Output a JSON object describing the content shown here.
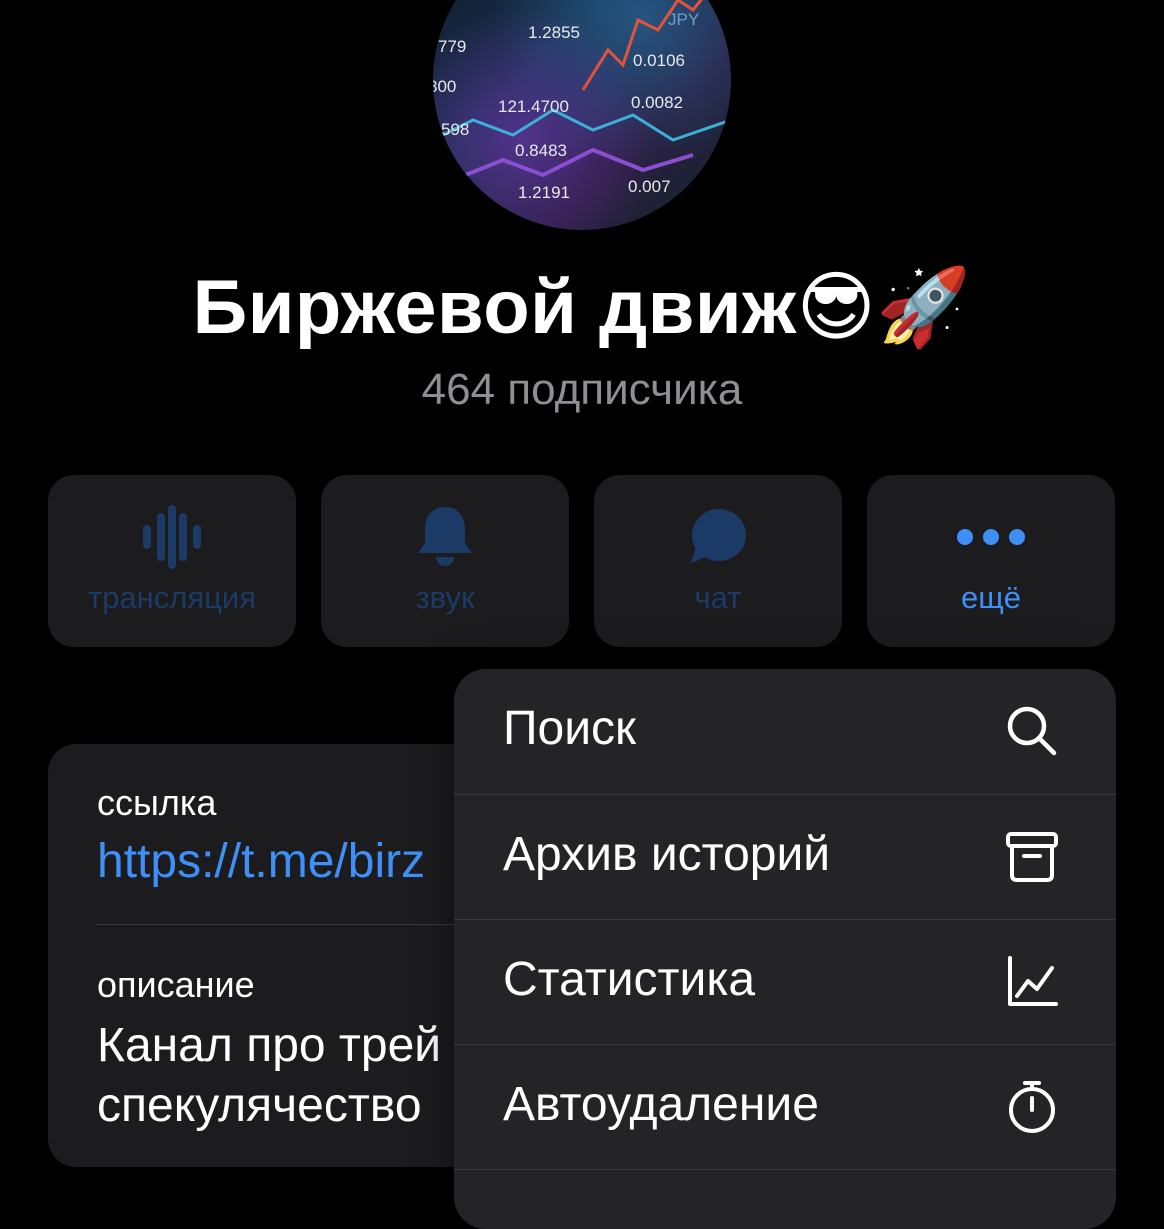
{
  "channel": {
    "title": "Биржевой движ😎🚀",
    "subscribers": "464 подписчика",
    "avatar_numbers": [
      "1.2855",
      "JPY",
      "779",
      "0.0106",
      "800",
      "121.4700",
      "0.0082",
      "598",
      "0.8483",
      "1.2191",
      "0.007"
    ]
  },
  "actions": [
    {
      "label": "трансляция",
      "icon": "broadcast-icon",
      "active": false
    },
    {
      "label": "звук",
      "icon": "bell-icon",
      "active": false
    },
    {
      "label": "чат",
      "icon": "chat-bubble-icon",
      "active": false
    },
    {
      "label": "ещё",
      "icon": "more-dots-icon",
      "active": true
    }
  ],
  "info": {
    "link_caption": "ссылка",
    "link_value": "https://t.me/birz",
    "description_caption": "описание",
    "description_value": "Канал про трей\nспекулячество"
  },
  "menu": {
    "items": [
      {
        "label": "Поиск",
        "icon": "search-icon"
      },
      {
        "label": "Архив историй",
        "icon": "archive-box-icon"
      },
      {
        "label": "Статистика",
        "icon": "chart-line-icon"
      },
      {
        "label": "Автоудаление",
        "icon": "stopwatch-icon"
      }
    ]
  },
  "colors": {
    "background": "#000000",
    "card": "#1c1c1e",
    "menu": "#242426",
    "accent": "#3e8ff8",
    "dim_accent": "#1b3a66",
    "secondary_text": "#8e8e93"
  }
}
